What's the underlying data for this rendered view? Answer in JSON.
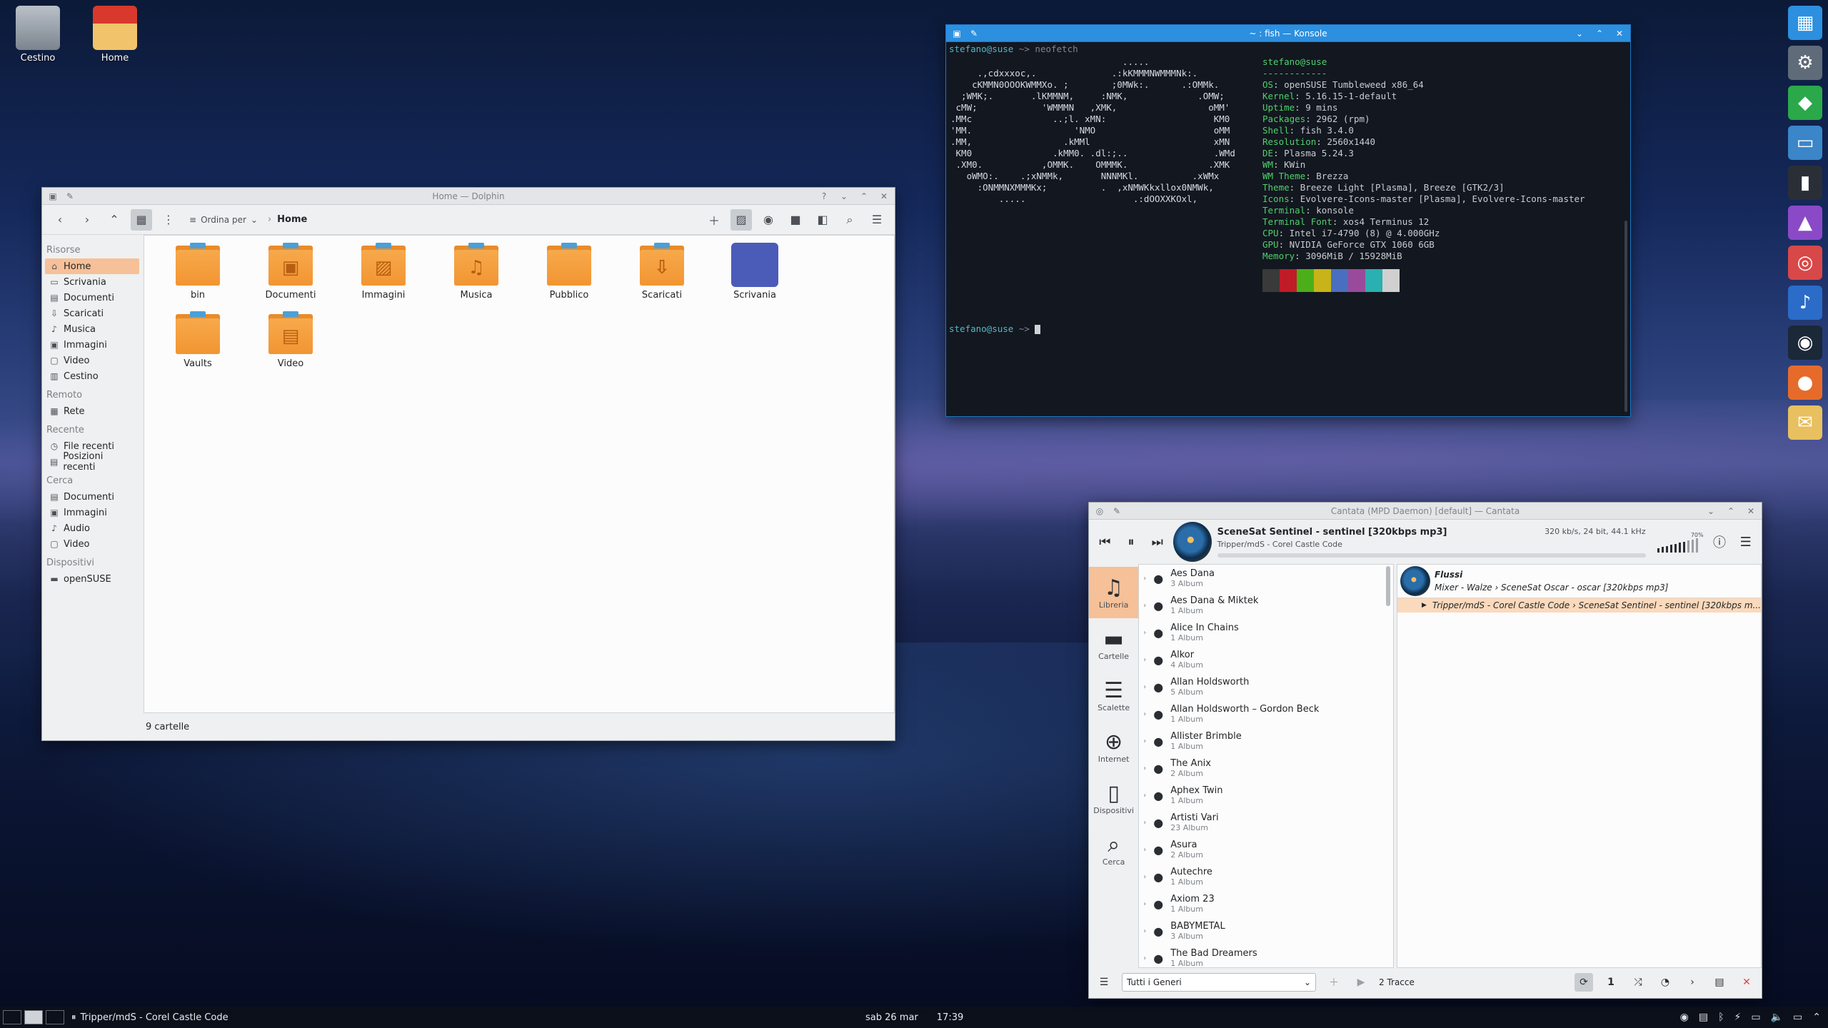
{
  "desktop": {
    "icons": [
      {
        "label": "Cestino"
      },
      {
        "label": "Home"
      }
    ]
  },
  "dolphin": {
    "title": "Home — Dolphin",
    "sort_label": "Ordina per",
    "breadcrumb": "Home",
    "places": {
      "risorse_title": "Risorse",
      "risorse": [
        "Home",
        "Scrivania",
        "Documenti",
        "Scaricati",
        "Musica",
        "Immagini",
        "Video",
        "Cestino"
      ],
      "remoto_title": "Remoto",
      "remoto": [
        "Rete"
      ],
      "recente_title": "Recente",
      "recente": [
        "File recenti",
        "Posizioni recenti"
      ],
      "cerca_title": "Cerca",
      "cerca": [
        "Documenti",
        "Immagini",
        "Audio",
        "Video"
      ],
      "dispositivi_title": "Dispositivi",
      "dispositivi": [
        "openSUSE"
      ]
    },
    "folders": [
      "bin",
      "Documenti",
      "Immagini",
      "Musica",
      "Pubblico",
      "Scaricati",
      "Scrivania",
      "Vaults",
      "Video"
    ],
    "status": "9 cartelle"
  },
  "konsole": {
    "title": "~ : fish — Konsole",
    "prompt_user": "stefano@suse",
    "prompt_sep": " ~> ",
    "command": "neofetch",
    "ascii": [
      "                                .....",
      "     .,cdxxxoc,.              .:kKMMMNWMMMNk:.",
      "    cKMMN0OOOKWMMXo. ;        ;0MWk:.      .:OMMk.",
      "  ;WMK;.       .lKMMNM,     :NMK,             .OMW;",
      " cMW;            'WMMMN   ,XMK,                 oMM'",
      ".MMc               ..;l. xMN:                    KM0",
      "'MM.                   'NMO                      oMM",
      ".MM,                 .kMMl                       xMN",
      " KM0               .kMM0. .dl:;..                .WMd",
      " .XM0.           ,OMMK.    OMMMK.               .XMK",
      "   oWMO:.    .;xNMMk,       NNNMKl.          .xWMx",
      "     :ONMMNXMMMKx;          .  ,xNMWKkxllox0NMWk,",
      "         .....                    .:dOOXXKOxl,"
    ],
    "info_head": "stefano@suse",
    "info_sep": "------------",
    "info": [
      {
        "k": "OS",
        "v": "openSUSE Tumbleweed x86_64"
      },
      {
        "k": "Kernel",
        "v": "5.16.15-1-default"
      },
      {
        "k": "Uptime",
        "v": "9 mins"
      },
      {
        "k": "Packages",
        "v": "2962 (rpm)"
      },
      {
        "k": "Shell",
        "v": "fish 3.4.0"
      },
      {
        "k": "Resolution",
        "v": "2560x1440"
      },
      {
        "k": "DE",
        "v": "Plasma 5.24.3"
      },
      {
        "k": "WM",
        "v": "KWin"
      },
      {
        "k": "WM Theme",
        "v": "Brezza"
      },
      {
        "k": "Theme",
        "v": "Breeze Light [Plasma], Breeze [GTK2/3]"
      },
      {
        "k": "Icons",
        "v": "Evolvere-Icons-master [Plasma], Evolvere-Icons-master"
      },
      {
        "k": "Terminal",
        "v": "konsole"
      },
      {
        "k": "Terminal Font",
        "v": "xos4 Terminus 12"
      },
      {
        "k": "CPU",
        "v": "Intel i7-4790 (8) @ 4.000GHz"
      },
      {
        "k": "GPU",
        "v": "NVIDIA GeForce GTX 1060 6GB"
      },
      {
        "k": "Memory",
        "v": "3096MiB / 15928MiB"
      }
    ],
    "palette": [
      "#3a3a3a",
      "#c01c28",
      "#4caf1a",
      "#c8b418",
      "#4a6fc0",
      "#9a4a9a",
      "#2ab0b0",
      "#d0d0d0"
    ]
  },
  "cantata": {
    "title": "Cantata (MPD Daemon) [default] — Cantata",
    "track_title": "SceneSat Sentinel - sentinel [320kbps mp3]",
    "track_sub": "Tripper/mdS - Corel Castle Code",
    "format": "320 kb/s, 24 bit, 44.1 kHz",
    "volume_label": "70%",
    "progress": 0.0,
    "nav": [
      {
        "label": "Libreria",
        "icon": "music-note-icon"
      },
      {
        "label": "Cartelle",
        "icon": "folder-icon"
      },
      {
        "label": "Scalette",
        "icon": "list-icon"
      },
      {
        "label": "Internet",
        "icon": "globe-icon"
      },
      {
        "label": "Dispositivi",
        "icon": "phone-icon"
      },
      {
        "label": "Cerca",
        "icon": "search-icon"
      }
    ],
    "artists": [
      {
        "name": "Aes Dana",
        "count": "3 Album"
      },
      {
        "name": "Aes Dana & Miktek",
        "count": "1 Album"
      },
      {
        "name": "Alice In Chains",
        "count": "1 Album"
      },
      {
        "name": "Alkor",
        "count": "4 Album"
      },
      {
        "name": "Allan Holdsworth",
        "count": "5 Album"
      },
      {
        "name": "Allan Holdsworth – Gordon Beck",
        "count": "1 Album"
      },
      {
        "name": "Allister Brimble",
        "count": "1 Album"
      },
      {
        "name": "The Anix",
        "count": "2 Album"
      },
      {
        "name": "Aphex Twin",
        "count": "1 Album"
      },
      {
        "name": "Artisti Vari",
        "count": "23 Album"
      },
      {
        "name": "Asura",
        "count": "2 Album"
      },
      {
        "name": "Autechre",
        "count": "1 Album"
      },
      {
        "name": "Axiom 23",
        "count": "1 Album"
      },
      {
        "name": "BABYMETAL",
        "count": "3 Album"
      },
      {
        "name": "The Bad Dreamers",
        "count": "1 Album"
      }
    ],
    "queue": {
      "group_title": "Flussi",
      "group_sub": "Mixer - Walze › SceneSat Oscar - oscar [320kbps mp3]",
      "playing": "Tripper/mdS - Corel Castle Code › SceneSat Sentinel - sentinel [320kbps m..."
    },
    "genre_select": "Tutti i Generi",
    "track_count": "2 Tracce",
    "repeat_count": "1"
  },
  "taskbar": {
    "task_label": "Tripper/mdS - Corel Castle Code",
    "date": "sab 26 mar",
    "time": "17:39"
  }
}
